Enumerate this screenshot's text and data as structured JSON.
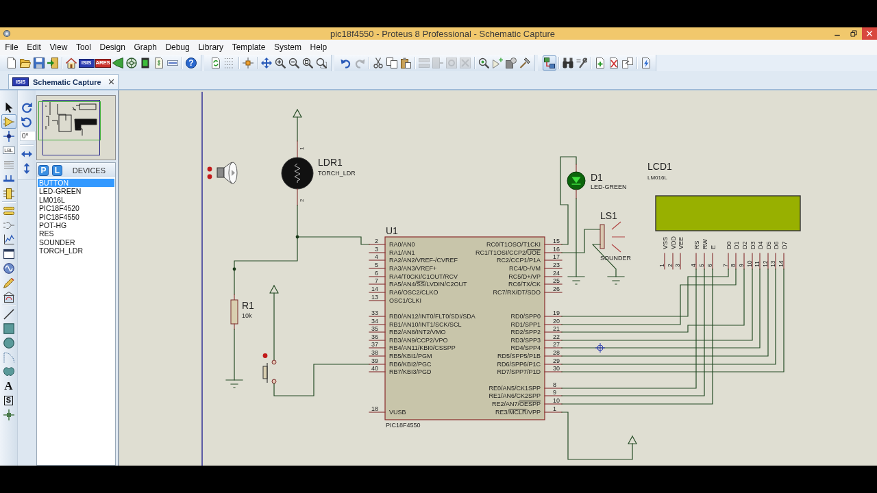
{
  "window": {
    "title": "pic18f4550 - Proteus 8 Professional - Schematic Capture"
  },
  "menu": [
    "File",
    "Edit",
    "View",
    "Tool",
    "Design",
    "Graph",
    "Debug",
    "Library",
    "Template",
    "System",
    "Help"
  ],
  "toolbars": [
    {
      "groups": [
        [
          {
            "kind": "new",
            "selected": false,
            "disabled": false
          },
          {
            "kind": "open",
            "selected": false,
            "disabled": false
          },
          {
            "kind": "save",
            "selected": false,
            "disabled": false
          },
          {
            "kind": "import",
            "selected": false,
            "disabled": false
          }
        ],
        [
          {
            "kind": "home",
            "selected": false,
            "disabled": false
          },
          {
            "kind": "isis",
            "glyph": "ISIS",
            "selected": false,
            "disabled": false
          },
          {
            "kind": "ares",
            "glyph": "ARES",
            "selected": false,
            "disabled": false
          },
          {
            "kind": "viewer3d",
            "selected": false,
            "disabled": false
          },
          {
            "kind": "gerber",
            "selected": false,
            "disabled": false
          },
          {
            "kind": "bom",
            "selected": false,
            "disabled": false
          },
          {
            "kind": "cost",
            "selected": false,
            "disabled": false
          },
          {
            "kind": "explorer",
            "selected": false,
            "disabled": false
          }
        ],
        [
          {
            "kind": "help",
            "glyph": "?",
            "selected": false,
            "disabled": false
          }
        ]
      ]
    },
    {
      "groups": [
        [
          {
            "kind": "refresh",
            "selected": false,
            "disabled": false
          },
          {
            "kind": "grid",
            "selected": false,
            "disabled": false
          }
        ],
        [
          {
            "kind": "origin",
            "selected": false,
            "disabled": false
          }
        ],
        [
          {
            "kind": "pan",
            "selected": false,
            "disabled": false
          },
          {
            "kind": "zoom_in",
            "selected": false,
            "disabled": false
          },
          {
            "kind": "zoom_out",
            "selected": false,
            "disabled": false
          },
          {
            "kind": "zoom_all",
            "selected": false,
            "disabled": false
          },
          {
            "kind": "zoom_area",
            "selected": false,
            "disabled": false
          }
        ]
      ]
    },
    {
      "groups": [
        [
          {
            "kind": "undo",
            "selected": false,
            "disabled": false
          },
          {
            "kind": "redo",
            "selected": false,
            "disabled": true
          }
        ],
        [
          {
            "kind": "cut",
            "selected": false,
            "disabled": false
          },
          {
            "kind": "copy",
            "selected": false,
            "disabled": false
          },
          {
            "kind": "paste",
            "selected": false,
            "disabled": false
          }
        ],
        [
          {
            "kind": "block_copy",
            "selected": false,
            "disabled": true
          },
          {
            "kind": "block_move",
            "selected": false,
            "disabled": true
          },
          {
            "kind": "block_rotate",
            "selected": false,
            "disabled": true
          },
          {
            "kind": "block_delete",
            "selected": false,
            "disabled": true
          }
        ],
        [
          {
            "kind": "pick",
            "selected": false,
            "disabled": false
          },
          {
            "kind": "make_device",
            "selected": false,
            "disabled": false
          },
          {
            "kind": "packaging",
            "selected": false,
            "disabled": false
          },
          {
            "kind": "decompose",
            "selected": false,
            "disabled": false
          }
        ]
      ]
    },
    {
      "groups": [
        [
          {
            "kind": "autoroute",
            "selected": true,
            "disabled": false
          }
        ],
        [
          {
            "kind": "search",
            "selected": false,
            "disabled": false
          },
          {
            "kind": "property",
            "selected": false,
            "disabled": false
          }
        ],
        [
          {
            "kind": "new_sheet",
            "selected": false,
            "disabled": false
          },
          {
            "kind": "remove_sheet",
            "selected": false,
            "disabled": false
          },
          {
            "kind": "goto_sheet",
            "selected": false,
            "disabled": false
          }
        ],
        [
          {
            "kind": "netlist",
            "selected": false,
            "disabled": false
          }
        ]
      ]
    }
  ],
  "tabs": [
    {
      "label": "Schematic Capture",
      "logo": "ISIS",
      "selected": true
    }
  ],
  "mode_tools": [
    [
      {
        "kind": "select",
        "selected": false
      },
      {
        "kind": "component",
        "selected": true
      },
      {
        "kind": "junction",
        "selected": false
      },
      {
        "kind": "label",
        "glyph": "LBL",
        "selected": false
      },
      {
        "kind": "script",
        "selected": false
      },
      {
        "kind": "bus",
        "selected": false
      },
      {
        "kind": "subcircuit",
        "selected": false
      }
    ],
    [
      {
        "kind": "terminals",
        "selected": false
      },
      {
        "kind": "pins",
        "selected": false
      },
      {
        "kind": "graph",
        "selected": false
      },
      {
        "kind": "tape",
        "selected": false
      },
      {
        "kind": "generator",
        "selected": false
      },
      {
        "kind": "probe",
        "selected": false
      },
      {
        "kind": "instrument",
        "selected": false
      }
    ],
    [
      {
        "kind": "line",
        "selected": false
      },
      {
        "kind": "box",
        "selected": false
      },
      {
        "kind": "circle",
        "selected": false
      },
      {
        "kind": "arc",
        "selected": false
      },
      {
        "kind": "path",
        "selected": false
      },
      {
        "kind": "text",
        "glyph": "A",
        "selected": false
      },
      {
        "kind": "symbol",
        "glyph": "S",
        "selected": false
      },
      {
        "kind": "marker",
        "selected": false
      }
    ]
  ],
  "orientation": {
    "angle": "0°"
  },
  "devices": {
    "pick_buttons": [
      "P",
      "L"
    ],
    "title": "DEVICES",
    "items": [
      {
        "label": "BUTTON",
        "selected": true
      },
      {
        "label": "LED-GREEN",
        "selected": false
      },
      {
        "label": "LM016L",
        "selected": false
      },
      {
        "label": "PIC18F4520",
        "selected": false
      },
      {
        "label": "PIC18F4550",
        "selected": false
      },
      {
        "label": "POT-HG",
        "selected": false
      },
      {
        "label": "RES",
        "selected": false
      },
      {
        "label": "SOUNDER",
        "selected": false
      },
      {
        "label": "TORCH_LDR",
        "selected": false
      }
    ]
  },
  "schematic": {
    "ldr": {
      "reference": "LDR1",
      "value": "TORCH_LDR",
      "pins": [
        "1",
        "2"
      ]
    },
    "resistor": {
      "reference": "R1",
      "value": "10k"
    },
    "mcu": {
      "reference": "U1",
      "value": "PIC18F4550",
      "left_pins": [
        [
          {
            "number": "2",
            "label": "RA0/AN0"
          },
          {
            "number": "3",
            "label": "RA1/AN1"
          },
          {
            "number": "4",
            "label": "RA2/AN2/VREF-/CVREF"
          },
          {
            "number": "5",
            "label": "RA3/AN3/VREF+"
          },
          {
            "number": "6",
            "label": "RA4/T0CKI/C1OUT/RCV"
          },
          {
            "number": "7",
            "label_parts": [
              {
                "text": "RA5/AN4/",
                "overline": false
              },
              {
                "text": "SS",
                "overline": true
              },
              {
                "text": "/LVDIN/C2OUT",
                "overline": false
              }
            ]
          },
          {
            "number": "14",
            "label": "RA6/OSC2/CLKO"
          },
          {
            "number": "13",
            "label": "OSC1/CLKI"
          }
        ],
        [
          {
            "number": "33",
            "label": "RB0/AN12/INT0/FLT0/SDI/SDA"
          },
          {
            "number": "34",
            "label": "RB1/AN10/INT1/SCK/SCL"
          },
          {
            "number": "35",
            "label": "RB2/AN8/INT2/VMO"
          },
          {
            "number": "36",
            "label": "RB3/AN9/CCP2/VPO"
          },
          {
            "number": "37",
            "label": "RB4/AN11/KBI0/CSSPP"
          },
          {
            "number": "38",
            "label": "RB5/KBI1/PGM"
          },
          {
            "number": "39",
            "label": "RB6/KBI2/PGC"
          },
          {
            "number": "40",
            "label": "RB7/KBI3/PGD"
          }
        ],
        [
          {
            "number": "18",
            "label": "VUSB"
          }
        ]
      ],
      "right_pins": [
        [
          {
            "number": "15",
            "label": "RC0/T1OSO/T1CKI"
          },
          {
            "number": "16",
            "label_parts": [
              {
                "text": "RC1/T1OSI/CCP2/",
                "overline": false
              },
              {
                "text": "UOE",
                "overline": true
              }
            ]
          },
          {
            "number": "17",
            "label": "RC2/CCP1/P1A"
          },
          {
            "number": "23",
            "label": "RC4/D-/VM"
          },
          {
            "number": "24",
            "label": "RC5/D+/VP"
          },
          {
            "number": "25",
            "label": "RC6/TX/CK"
          },
          {
            "number": "26",
            "label": "RC7/RX/DT/SDO"
          }
        ],
        [
          {
            "number": "19",
            "label": "RD0/SPP0"
          },
          {
            "number": "20",
            "label": "RD1/SPP1"
          },
          {
            "number": "21",
            "label": "RD2/SPP2"
          },
          {
            "number": "22",
            "label": "RD3/SPP3"
          },
          {
            "number": "27",
            "label": "RD4/SPP4"
          },
          {
            "number": "28",
            "label": "RD5/SPP5/P1B"
          },
          {
            "number": "29",
            "label": "RD6/SPP6/P1C"
          },
          {
            "number": "30",
            "label": "RD7/SPP7/P1D"
          }
        ],
        [
          {
            "number": "8",
            "label": "RE0/AN5/CK1SPP"
          },
          {
            "number": "9",
            "label": "RE1/AN6/CK2SPP"
          },
          {
            "number": "10",
            "label_parts": [
              {
                "text": "RE2/AN7/",
                "overline": false
              },
              {
                "text": "OESPP",
                "overline": true
              }
            ]
          },
          {
            "number": "1",
            "label_parts": [
              {
                "text": "RE3/",
                "overline": false
              },
              {
                "text": "MCLR",
                "overline": true
              },
              {
                "text": "/VPP",
                "overline": false
              }
            ]
          }
        ]
      ]
    },
    "led": {
      "reference": "D1",
      "value": "LED-GREEN"
    },
    "sounder": {
      "reference": "LS1",
      "value": "SOUNDER"
    },
    "lcd": {
      "reference": "LCD1",
      "value": "LM016L",
      "pins": [
        {
          "name": "VSS",
          "number": "1"
        },
        {
          "name": "VDD",
          "number": "2"
        },
        {
          "name": "VEE",
          "number": "3"
        },
        {
          "name": "RS",
          "number": "4"
        },
        {
          "name": "RW",
          "number": "5"
        },
        {
          "name": "E",
          "number": "6"
        },
        {
          "name": "D0",
          "number": "7"
        },
        {
          "name": "D1",
          "number": "8"
        },
        {
          "name": "D2",
          "number": "9"
        },
        {
          "name": "D3",
          "number": "10"
        },
        {
          "name": "D4",
          "number": "11"
        },
        {
          "name": "D5",
          "number": "12"
        },
        {
          "name": "D6",
          "number": "13"
        },
        {
          "name": "D7",
          "number": "14"
        }
      ]
    }
  }
}
